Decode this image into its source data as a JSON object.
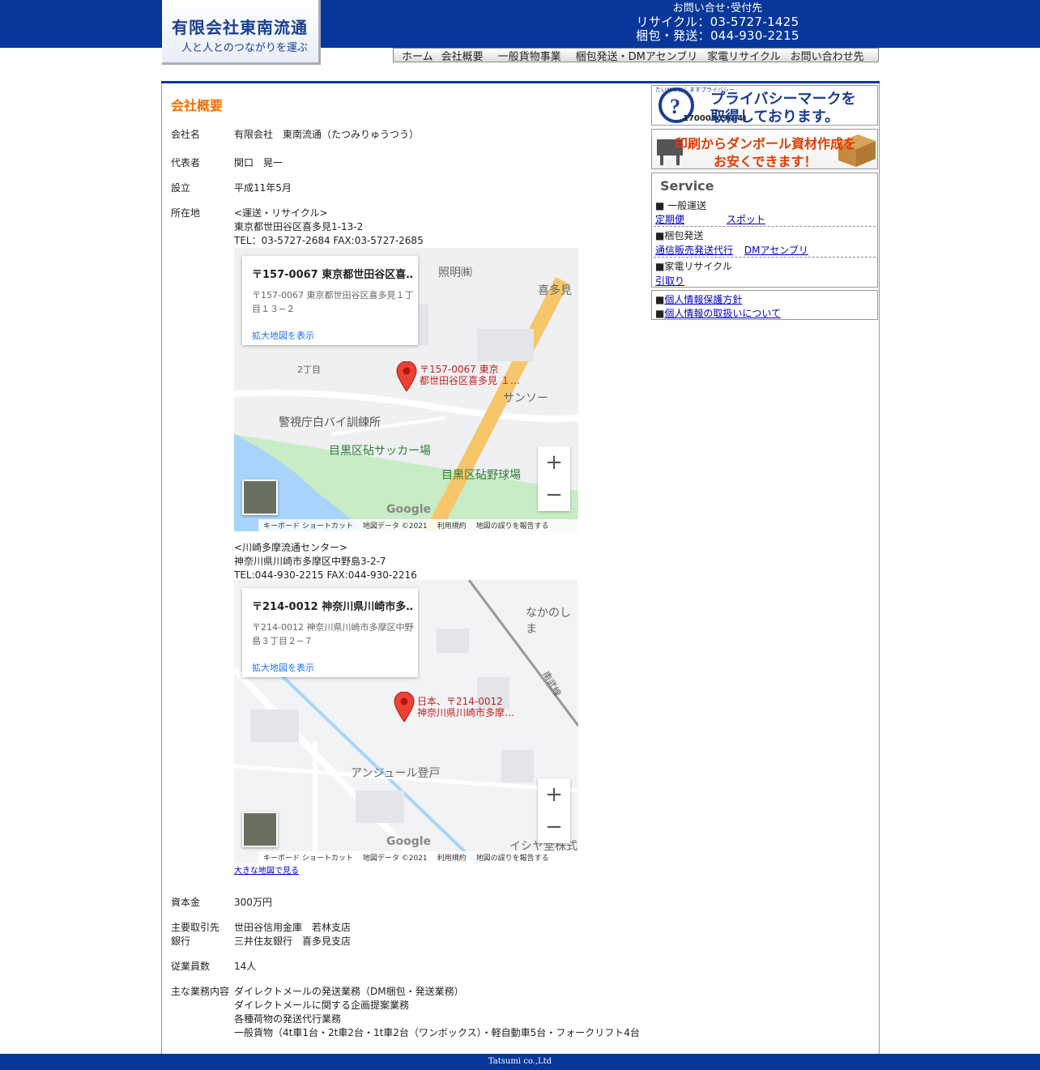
{
  "header": {
    "logo_title": "有限会社東南流通",
    "logo_tagline": "人と人とのつながりを運ぶ",
    "contact_title": "お問い合せ･受付先",
    "contact_recycle": "リサイクル：03-5727-1425",
    "contact_pack": "梱包・発送：044-930-2215"
  },
  "nav": [
    "ホーム",
    "会社概要",
    "一般貨物事業",
    "梱包発送・DMアセンブリ",
    "家電リサイクル",
    "お問い合わせ先"
  ],
  "page": {
    "title": "会社概要"
  },
  "company": {
    "name_label": "会社名",
    "name": "有限会社　東南流通（たつみりゅうつう）",
    "rep_label": "代表者",
    "rep": "関口　晃一",
    "est_label": "設立",
    "est": "平成11年5月",
    "addr_label": "所在地",
    "addr1_head": "<運送・リサイクル>",
    "addr1": "東京都世田谷区喜多見1-13-2",
    "addr1_tel": "TEL：03-5727-2684 FAX:03-5727-2685",
    "addr2_head": "<川崎多摩流通センター>",
    "addr2": "神奈川県川崎市多摩区中野島3-2-7",
    "addr2_tel": "TEL:044-930-2215 FAX:044-930-2216",
    "bigmap_link": "大きな地図で見る",
    "capital_label": "資本金",
    "capital": "300万円",
    "bank_label1": "主要取引先",
    "bank_label2": "銀行",
    "bank1": "世田谷信用金庫　若林支店",
    "bank2": "三井住友銀行　喜多見支店",
    "staff_label": "従業員数",
    "staff": "14人",
    "biz_label": "主な業務内容",
    "biz1": "ダイレクトメールの発送業務（DM梱包・発送業務）",
    "biz2": "ダイレクトメールに関する企画提案業務",
    "biz3": "各種荷物の発送代行業務",
    "biz4": "一般貨物（4t車1台・2t車2台・1t車2台（ワンボックス）・軽自動車5台・フォークリフト4台"
  },
  "map1": {
    "info_title": "〒157-0067 東京都世田谷区喜…",
    "info_addr": "〒157-0067 東京都世田谷区喜多見１丁目１３−２",
    "info_link": "拡大地図を表示",
    "pin_label1": "〒157-0067 東京",
    "pin_label2": "都世田谷区喜多見 １…",
    "labels": [
      "喜多見",
      "2丁目",
      "サンソー",
      "警視庁白バイ訓練所",
      "目黒区砧サッカー場",
      "目黒区砧野球場",
      "照明㈱"
    ]
  },
  "map2": {
    "info_title": "〒214-0012 神奈川県川崎市多…",
    "info_addr": "〒214-0012 神奈川県川崎市多摩区中野島３丁目２−７",
    "info_link": "拡大地図を表示",
    "pin_label1": "日本、〒214-0012",
    "pin_label2": "神奈川県川崎市多摩…",
    "labels": [
      "なかのしま",
      "南武線",
      "アンジュール登戸",
      "イシヤ堂株式"
    ]
  },
  "mapfooter": {
    "shortcut": "キーボード ショートカット",
    "data": "地図データ ©2021",
    "terms": "利用規約",
    "report": "地図の誤りを報告する",
    "google": "Google"
  },
  "sidebar": {
    "privacy_banner_line1": "プライバシーマークを",
    "privacy_banner_line2": "取得しております。",
    "privacy_number": "17000309(04)",
    "privacy_small": "たいせつにしますプライバシー",
    "print_banner_line1": "印刷からダンボール資材作成を",
    "print_banner_line2": "お安くできます！",
    "service_title": "Service",
    "svc1": "■ 一般運送",
    "svc1a": "定期便",
    "svc1b": "スポット",
    "svc2": "■梱包発送",
    "svc2a": "通信販売発送代行",
    "svc2b": "DMアセンブリ",
    "svc3": "■家電リサイクル",
    "svc3a": "引取り",
    "priv1": "個人情報保護方針",
    "priv2": "個人情報の取扱いについて"
  },
  "footer": {
    "text": "Tatsumi co.,Ltd"
  }
}
